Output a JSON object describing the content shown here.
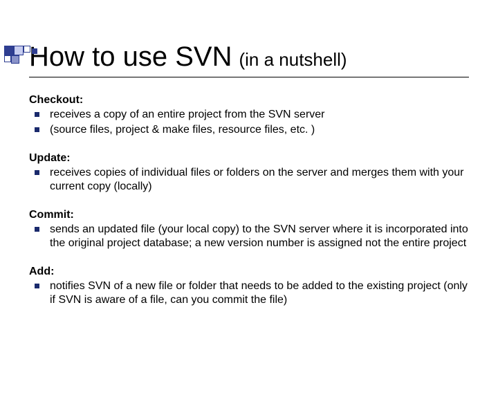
{
  "title": {
    "main": "How to use SVN",
    "sub": "(in a nutshell)"
  },
  "sections": [
    {
      "heading": "Checkout:",
      "items": [
        "receives a copy of an entire project from the SVN server",
        "(source files, project & make files, resource files, etc. )"
      ]
    },
    {
      "heading": "Update:",
      "items": [
        "receives copies of individual files or folders on the server and merges them with your current copy (locally)"
      ]
    },
    {
      "heading": "Commit:",
      "items": [
        "sends an updated file (your local copy) to the SVN server where it is incorporated into the original project database; a new version number is assigned not the entire project"
      ]
    },
    {
      "heading": "Add:",
      "items": [
        "notifies SVN of a new file or folder that needs to be added to the existing project (only if SVN is aware of a file, can you commit the file)"
      ]
    }
  ]
}
